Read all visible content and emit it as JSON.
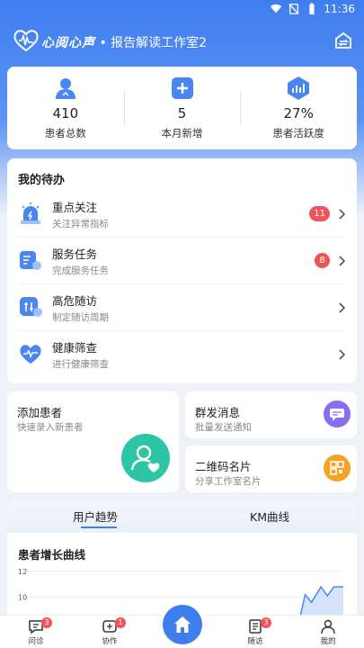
{
  "statusbar": {
    "time": "11:36"
  },
  "header": {
    "brand": "心阅心声",
    "separator": " • ",
    "studio": "报告解读工作室2"
  },
  "stats": [
    {
      "icon": "patient-icon",
      "value": "410",
      "label": "患者总数"
    },
    {
      "icon": "plus-icon",
      "value": "5",
      "label": "本月新增"
    },
    {
      "icon": "chart-icon",
      "value": "27%",
      "label": "患者活跃度"
    }
  ],
  "todo": {
    "title": "我的待办",
    "items": [
      {
        "name": "重点关注",
        "sub": "关注异常指标",
        "badge": "11",
        "icon": "alarm-icon"
      },
      {
        "name": "服务任务",
        "sub": "完成服务任务",
        "badge": "8",
        "icon": "document-icon"
      },
      {
        "name": "高危随访",
        "sub": "制定随访周期",
        "badge": "",
        "icon": "followup-icon"
      },
      {
        "name": "健康筛查",
        "sub": "进行健康筛查",
        "badge": "",
        "icon": "heart-pulse-icon"
      }
    ]
  },
  "quick": {
    "add_patient": {
      "name": "添加患者",
      "sub": "快速录入新患者"
    },
    "broadcast": {
      "name": "群发消息",
      "sub": "批量发送通知"
    },
    "qrcode": {
      "name": "二维码名片",
      "sub": "分享工作室名片"
    }
  },
  "tabs": {
    "active": "用户趋势",
    "other": "KM曲线"
  },
  "chart": {
    "title": "患者增长曲线"
  },
  "chart_data": {
    "type": "area",
    "title": "患者增长曲线",
    "y_ticks": [
      "12",
      "10"
    ],
    "ylim": [
      8,
      12
    ],
    "points": [
      {
        "x": 0.86,
        "y": 8
      },
      {
        "x": 0.88,
        "y": 10.2
      },
      {
        "x": 0.9,
        "y": 9.6
      },
      {
        "x": 0.93,
        "y": 10.8
      },
      {
        "x": 0.95,
        "y": 10.1
      },
      {
        "x": 0.97,
        "y": 10.8
      },
      {
        "x": 1.0,
        "y": 10.8
      }
    ]
  },
  "nav": [
    {
      "label": "问诊",
      "badge": "3"
    },
    {
      "label": "协作",
      "badge": "1"
    },
    {
      "label": "随访",
      "badge": "3"
    },
    {
      "label": "我的",
      "badge": ""
    }
  ],
  "colors": {
    "primary": "#3f7ef0",
    "badge": "#f0545b",
    "teal": "#2ec4a6",
    "purple": "#8a6cf0",
    "orange": "#f5a323"
  }
}
